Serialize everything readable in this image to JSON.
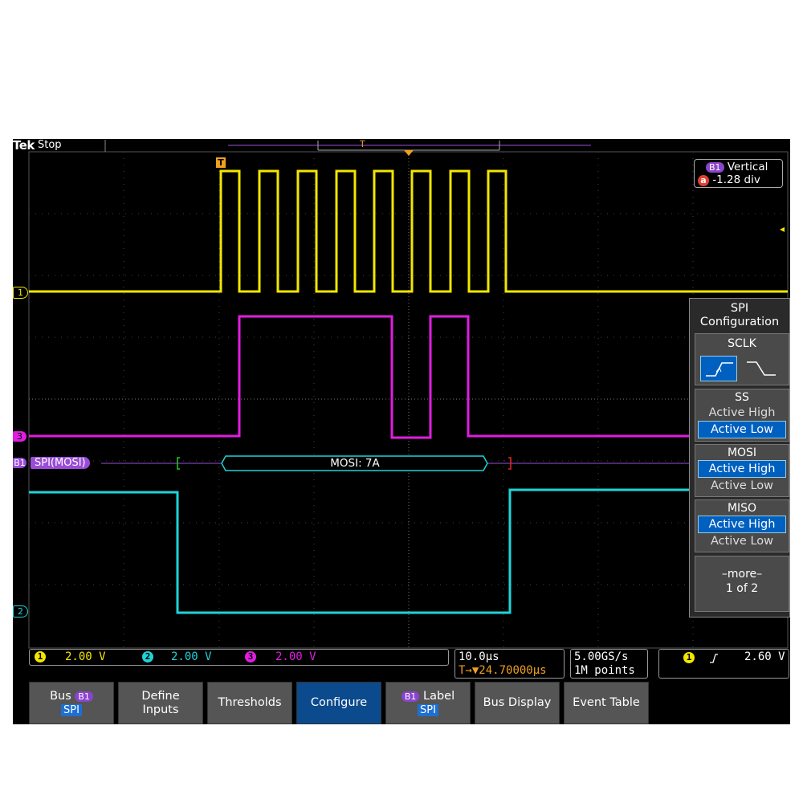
{
  "header": {
    "brand": "Tek",
    "state": "Stop"
  },
  "markers": {
    "trigger_top": "T",
    "trigger_left": "T"
  },
  "vertical_readout": {
    "badge": "B1",
    "title": "Vertical",
    "cursor_badge": "a",
    "value": "-1.28 div"
  },
  "channels": {
    "ch1_flag": "1",
    "ch2_flag": "2",
    "ch3_flag": "3",
    "b1_flag": "B1",
    "bus_label": "SPI(MOSI)",
    "decode_packet": "MOSI: 7A"
  },
  "colors": {
    "ch1": "#f2e600",
    "ch2": "#1fd3d8",
    "ch3": "#e01ee0",
    "bus": "#9a4cd8",
    "grid": "#555555"
  },
  "side_menu": {
    "title_line1": "SPI",
    "title_line2": "Configuration",
    "sclk": {
      "label": "SCLK",
      "rising_icon": "rising-edge-icon",
      "falling_icon": "falling-edge-icon"
    },
    "ss": {
      "label": "SS",
      "opt1": "Active High",
      "opt2": "Active Low",
      "selected": "Active Low"
    },
    "mosi": {
      "label": "MOSI",
      "opt1": "Active High",
      "opt2": "Active Low",
      "selected": "Active High"
    },
    "miso": {
      "label": "MISO",
      "opt1": "Active High",
      "opt2": "Active Low",
      "selected": "Active High"
    },
    "more_line1": "–more–",
    "more_line2": "1 of 2"
  },
  "status": {
    "ch1_num": "1",
    "ch1_scale": "2.00 V",
    "ch2_num": "2",
    "ch2_scale": "2.00 V",
    "ch3_num": "3",
    "ch3_scale": "2.00 V",
    "timebase": "10.0µs",
    "trigger_pos_icon": "T→▼",
    "trigger_pos": "24.70000µs",
    "sample_rate": "5.00GS/s",
    "record_length": "1M points",
    "trig_source": "1",
    "trig_slope_icon": "rising-slope-icon",
    "trig_level": "2.60 V"
  },
  "bottom_menu": {
    "bus_label": "Bus",
    "bus_badge": "B1",
    "bus_value": "SPI",
    "define_line1": "Define",
    "define_line2": "Inputs",
    "thresholds": "Thresholds",
    "configure": "Configure",
    "label_badge": "B1",
    "label_label": "Label",
    "label_value": "SPI",
    "bus_display": "Bus Display",
    "event_table": "Event Table"
  }
}
